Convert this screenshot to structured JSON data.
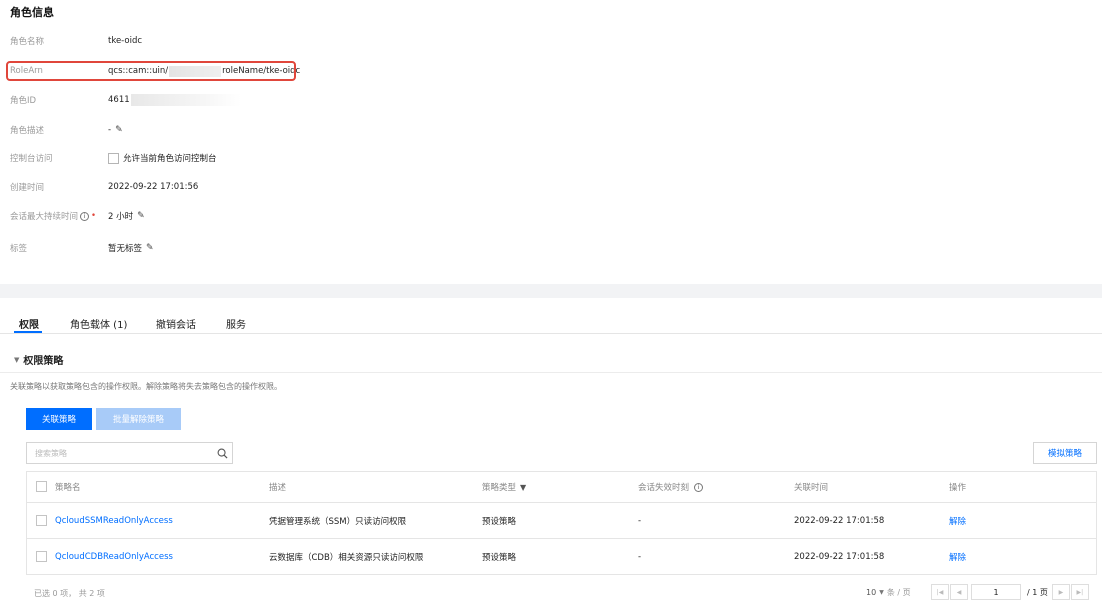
{
  "role_info": {
    "title": "角色信息",
    "rows": [
      {
        "label": "角色名称",
        "value": "tke-oidc"
      },
      {
        "label": "RoleArn",
        "value_prefix": "qcs::cam::uin/",
        "value_suffix": "roleName/tke-oidc"
      },
      {
        "label": "角色ID",
        "value": "4611"
      },
      {
        "label": "角色描述",
        "value": "-"
      },
      {
        "label": "控制台访问",
        "value": "允许当前角色访问控制台"
      },
      {
        "label": "创建时间",
        "value": "2022-09-22 17:01:56"
      },
      {
        "label": "会话最大持续时间",
        "value": "2 小时"
      },
      {
        "label": "标签",
        "value": "暂无标签"
      }
    ]
  },
  "tabs": [
    "权限",
    "角色载体 (1)",
    "撤销会话",
    "服务"
  ],
  "policy_section": {
    "title": "权限策略",
    "description": "关联策略以获取策略包含的操作权限。解除策略将失去策略包含的操作权限。",
    "attach_button": "关联策略",
    "batch_detach_button": "批量解除策略",
    "search_placeholder": "搜索策略",
    "simulate_button": "模拟策略"
  },
  "table": {
    "headers": [
      "策略名",
      "描述",
      "策略类型",
      "会话失效时刻",
      "关联时间",
      "操作"
    ],
    "rows": [
      {
        "name": "QcloudSSMReadOnlyAccess",
        "desc": "凭据管理系统（SSM）只读访问权限",
        "type": "预设策略",
        "expire": "-",
        "time": "2022-09-22 17:01:58",
        "action": "解除"
      },
      {
        "name": "QcloudCDBReadOnlyAccess",
        "desc": "云数据库（CDB）相关资源只读访问权限",
        "type": "预设策略",
        "expire": "-",
        "time": "2022-09-22 17:01:58",
        "action": "解除"
      }
    ]
  },
  "footer": {
    "selection": "已选 0 项， 共 2 项",
    "page_size": "10",
    "per_page_unit": "条 / 页",
    "current_page": "1",
    "total_pages": "/ 1 页"
  },
  "colors": {
    "primary": "#006eff",
    "highlight": "#e0463b"
  }
}
